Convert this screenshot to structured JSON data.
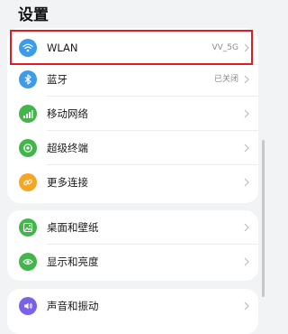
{
  "header": {
    "title": "设置"
  },
  "groups": [
    {
      "items": [
        {
          "label": "WLAN",
          "value": "VV_5G",
          "icon": "wifi-icon",
          "color": "#3d9be9"
        },
        {
          "label": "蓝牙",
          "value": "已关闭",
          "icon": "bluetooth-icon",
          "color": "#3d9be9"
        },
        {
          "label": "移动网络",
          "value": "",
          "icon": "mobile-network-icon",
          "color": "#42b54b"
        },
        {
          "label": "超级终端",
          "value": "",
          "icon": "super-device-icon",
          "color": "#42b54b"
        },
        {
          "label": "更多连接",
          "value": "",
          "icon": "link-icon",
          "color": "#f5a623"
        }
      ]
    },
    {
      "items": [
        {
          "label": "桌面和壁纸",
          "value": "",
          "icon": "wallpaper-icon",
          "color": "#42b54b"
        },
        {
          "label": "显示和亮度",
          "value": "",
          "icon": "display-icon",
          "color": "#42b54b"
        }
      ]
    },
    {
      "items": [
        {
          "label": "声音和振动",
          "value": "",
          "icon": "sound-icon",
          "color": "#7b61e8"
        }
      ]
    }
  ],
  "colors": {
    "highlight": "#e01b22",
    "background": "#f1f3f5",
    "card": "#ffffff"
  }
}
